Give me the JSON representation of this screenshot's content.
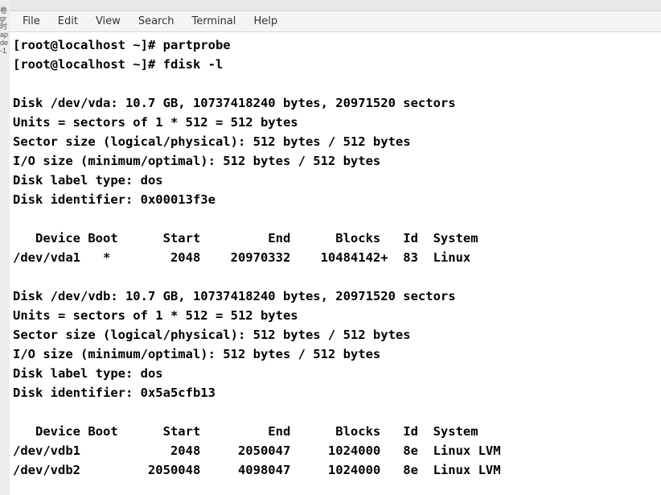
{
  "left_edge": {
    "chars": "卷\ngr\n时\nap\nde\n\n\n\n\n\n\n\n\n\n-1"
  },
  "menubar": {
    "items": [
      {
        "label": "File"
      },
      {
        "label": "Edit"
      },
      {
        "label": "View"
      },
      {
        "label": "Search"
      },
      {
        "label": "Terminal"
      },
      {
        "label": "Help"
      }
    ]
  },
  "terminal": {
    "prompt1": "[root@localhost ~]# partprobe",
    "prompt2": "[root@localhost ~]# fdisk -l",
    "blank1": "",
    "disk_a": {
      "header": "Disk /dev/vda: 10.7 GB, 10737418240 bytes, 20971520 sectors",
      "units": "Units = sectors of 1 * 512 = 512 bytes",
      "sector": "Sector size (logical/physical): 512 bytes / 512 bytes",
      "io": "I/O size (minimum/optimal): 512 bytes / 512 bytes",
      "label_type": "Disk label type: dos",
      "identifier": "Disk identifier: 0x00013f3e",
      "blank": "",
      "columns": "   Device Boot      Start         End      Blocks   Id  System",
      "row1": "/dev/vda1   *        2048    20970332    10484142+  83  Linux"
    },
    "blank2": "",
    "disk_b": {
      "header": "Disk /dev/vdb: 10.7 GB, 10737418240 bytes, 20971520 sectors",
      "units": "Units = sectors of 1 * 512 = 512 bytes",
      "sector": "Sector size (logical/physical): 512 bytes / 512 bytes",
      "io": "I/O size (minimum/optimal): 512 bytes / 512 bytes",
      "label_type": "Disk label type: dos",
      "identifier": "Disk identifier: 0x5a5cfb13",
      "blank": "",
      "columns": "   Device Boot      Start         End      Blocks   Id  System",
      "row1": "/dev/vdb1            2048     2050047     1024000   8e  Linux LVM",
      "row2": "/dev/vdb2         2050048     4098047     1024000   8e  Linux LVM"
    }
  }
}
